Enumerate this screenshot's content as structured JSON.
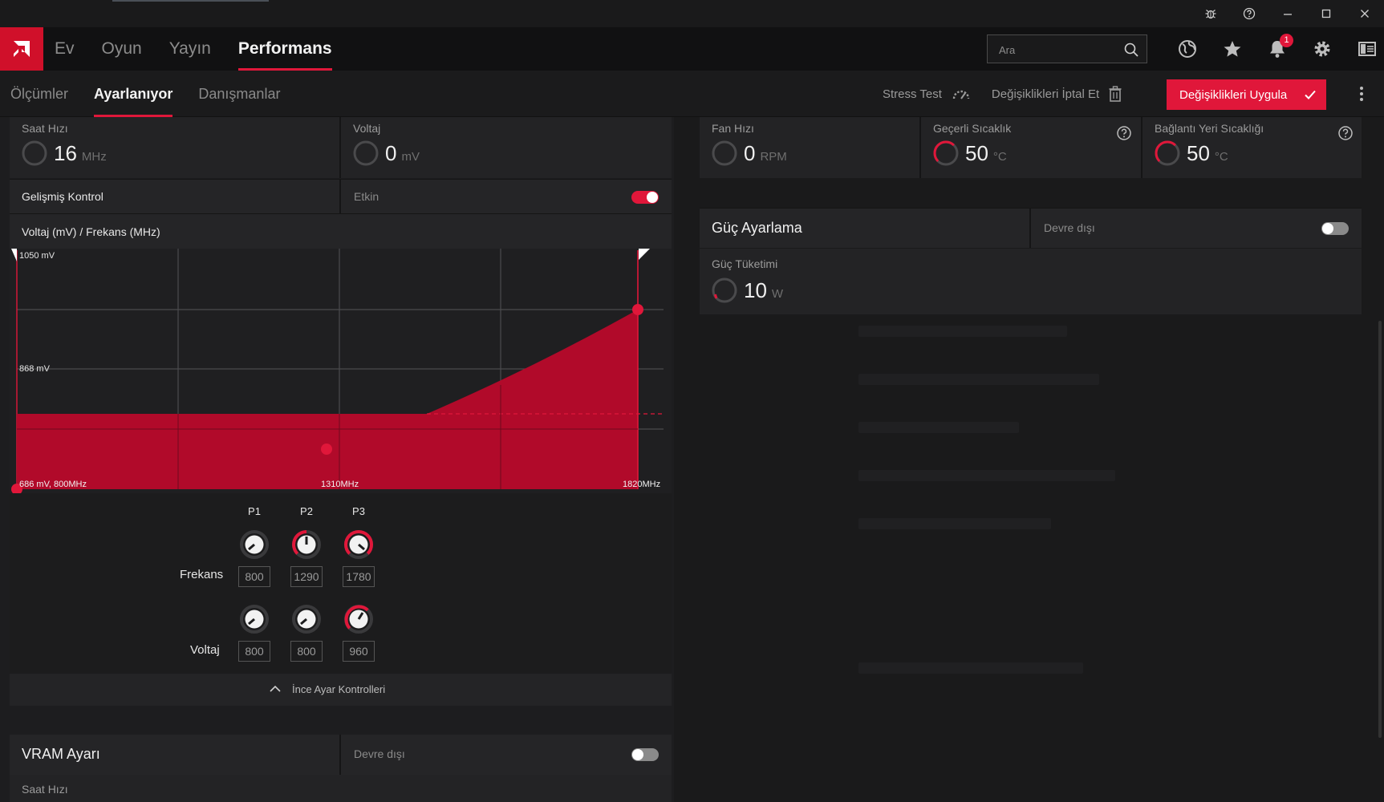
{
  "nav": {
    "items": [
      "Ev",
      "Oyun",
      "Yayın",
      "Performans"
    ],
    "search_placeholder": "Ara",
    "notification_count": "1"
  },
  "subnav": {
    "items": [
      "Ölçümler",
      "Ayarlanıyor",
      "Danışmanlar"
    ],
    "stress_test": "Stress Test",
    "discard": "Değişiklikleri İptal Et",
    "apply": "Değişiklikleri Uygula"
  },
  "gpu": {
    "clock_label": "Saat Hızı",
    "clock_value": "16",
    "clock_unit": "MHz",
    "voltage_label": "Voltaj",
    "voltage_value": "0",
    "voltage_unit": "mV",
    "advanced_label": "Gelişmiş Kontrol",
    "advanced_state": "Etkin",
    "curve_title": "Voltaj (mV) / Frekans (MHz)"
  },
  "curve": {
    "y_top_label": "1050 mV",
    "y_mid_label": "868 mV",
    "x_start_label": "686 mV, 800MHz",
    "x_mid_label": "1310MHz",
    "x_end_label": "1820MHz"
  },
  "states": {
    "labels": [
      "P1",
      "P2",
      "P3"
    ],
    "freq_label": "Frekans",
    "freq_values": [
      "800",
      "1290",
      "1780"
    ],
    "volt_label": "Voltaj",
    "volt_values": [
      "800",
      "800",
      "960"
    ]
  },
  "fine_tune": {
    "label": "İnce Ayar Kontrolleri"
  },
  "vram": {
    "title": "VRAM Ayarı",
    "state": "Devre dışı",
    "clock_label": "Saat Hızı"
  },
  "fan": {
    "speed_label": "Fan Hızı",
    "speed_value": "0",
    "speed_unit": "RPM"
  },
  "temp": {
    "current_label": "Geçerli Sıcaklık",
    "current_value": "50",
    "current_unit": "°C",
    "junction_label": "Bağlantı Yeri Sıcaklığı",
    "junction_value": "50",
    "junction_unit": "°C"
  },
  "power": {
    "title": "Güç Ayarlama",
    "state": "Devre dışı",
    "consumption_label": "Güç Tüketimi",
    "consumption_value": "10",
    "consumption_unit": "W"
  },
  "colors": {
    "accent": "#e0173a",
    "fill": "#b10a2a"
  }
}
